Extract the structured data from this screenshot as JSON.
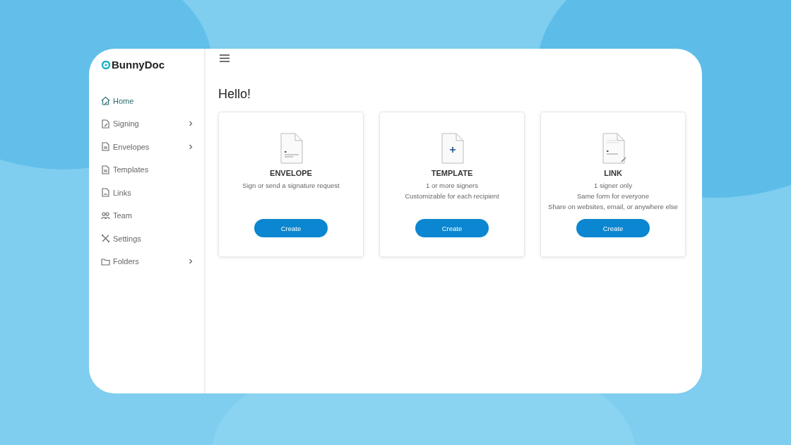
{
  "brand": {
    "name": "BunnyDoc"
  },
  "sidebar": {
    "items": [
      {
        "label": "Home",
        "kind": "home",
        "selected": true,
        "has_submenu": false
      },
      {
        "label": "Signing",
        "kind": "signing",
        "selected": false,
        "has_submenu": true
      },
      {
        "label": "Envelopes",
        "kind": "envelopes",
        "selected": false,
        "has_submenu": true
      },
      {
        "label": "Templates",
        "kind": "templates",
        "selected": false,
        "has_submenu": false
      },
      {
        "label": "Links",
        "kind": "links",
        "selected": false,
        "has_submenu": false
      },
      {
        "label": "Team",
        "kind": "team",
        "selected": false,
        "has_submenu": false
      },
      {
        "label": "Settings",
        "kind": "settings",
        "selected": false,
        "has_submenu": false
      },
      {
        "label": "Folders",
        "kind": "folders",
        "selected": false,
        "has_submenu": true
      }
    ]
  },
  "main": {
    "greeting": "Hello!",
    "cards": [
      {
        "kind": "envelope",
        "title": "ENVELOPE",
        "lines": [
          "Sign or send a signature request"
        ],
        "button": "Create"
      },
      {
        "kind": "template",
        "title": "TEMPLATE",
        "lines": [
          "1 or more signers",
          "Customizable for each recipient"
        ],
        "button": "Create"
      },
      {
        "kind": "link",
        "title": "LINK",
        "lines": [
          "1 signer only",
          "Same form for everyone",
          "Share on websites, email, or anywhere else"
        ],
        "button": "Create"
      }
    ]
  }
}
